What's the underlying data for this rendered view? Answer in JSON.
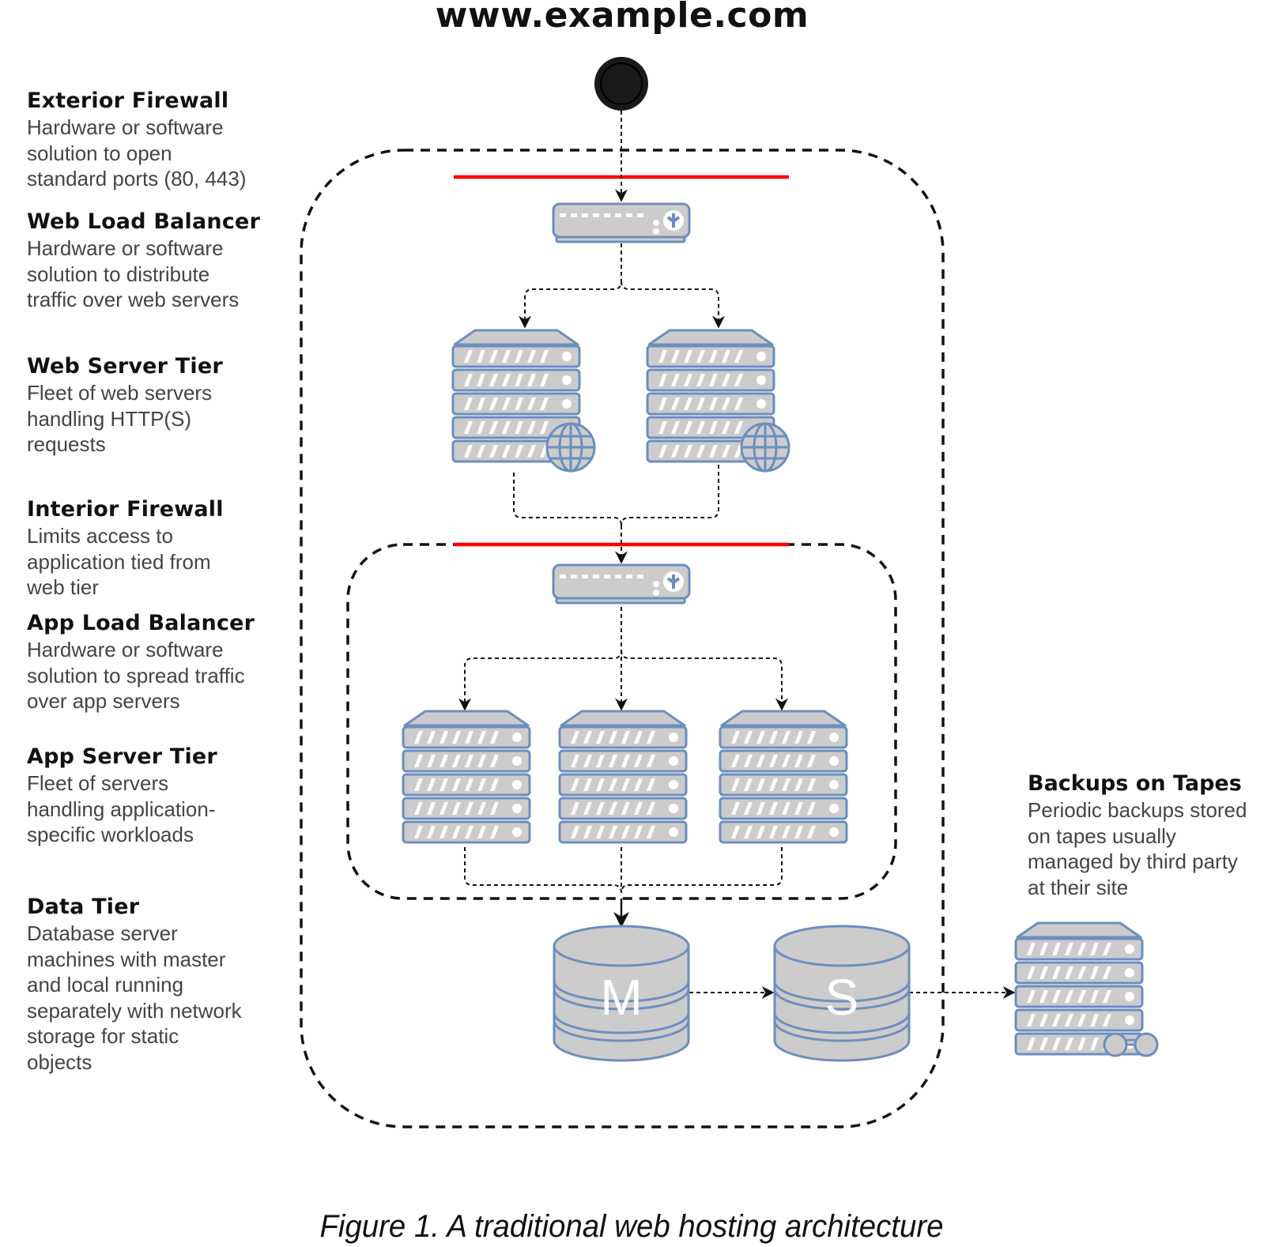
{
  "header": {
    "title": "www.example.com"
  },
  "tiers": [
    {
      "name": "Exterior Firewall",
      "description": "Hardware or software\nsolution to open\nstandard ports (80, 443)"
    },
    {
      "name": "Web Load Balancer",
      "description": "Hardware or software\nsolution to distribute\ntraffic over web servers"
    },
    {
      "name": "Web Server Tier",
      "description": "Fleet of web servers\nhandling HTTP(S)\nrequests"
    },
    {
      "name": "Interior Firewall",
      "description": "Limits access to\napplication tied from\nweb tier"
    },
    {
      "name": "App Load Balancer",
      "description": "Hardware or software\nsolution to spread traffic\nover app servers"
    },
    {
      "name": "App Server Tier",
      "description": "Fleet of servers\nhandling application-\nspecific workloads"
    },
    {
      "name": "Data Tier",
      "description": "Database server\nmachines with master\nand local running\nseparately with network\nstorage for static\nobjects"
    }
  ],
  "backup": {
    "name": "Backups on Tapes",
    "description": "Periodic backups stored\non tapes usually\nmanaged by third party\nat their site"
  },
  "databases": {
    "master_label": "M",
    "slave_label": "S"
  },
  "colors": {
    "firewall": "#ff0000",
    "device_fill": "#cccccc",
    "device_stroke": "#6c8ebf",
    "connector": "#111111",
    "entry_node": "#1a1a1a"
  },
  "caption": "Figure 1. A traditional web hosting architecture"
}
